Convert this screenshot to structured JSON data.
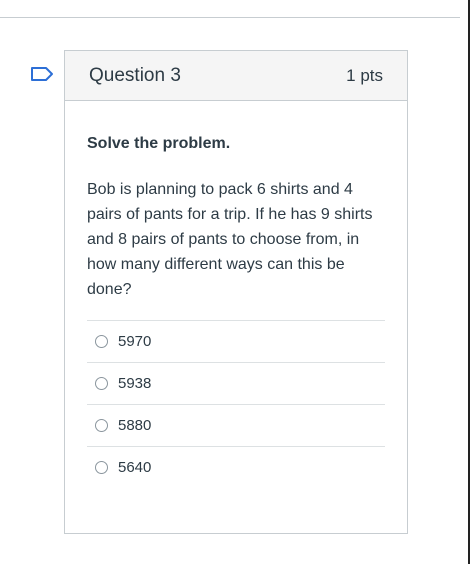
{
  "question": {
    "title": "Question 3",
    "points": "1 pts",
    "instruction": "Solve the problem.",
    "text": "Bob is planning to pack 6 shirts and 4 pairs of pants for a trip. If he has 9 shirts and 8 pairs of pants to choose from, in how many different ways can this be done?",
    "flag_icon": "bookmark-flag-icon",
    "accent_color": "#2d6fd6"
  },
  "answers": [
    {
      "label": "5970"
    },
    {
      "label": "5938"
    },
    {
      "label": "5880"
    },
    {
      "label": "5640"
    }
  ]
}
